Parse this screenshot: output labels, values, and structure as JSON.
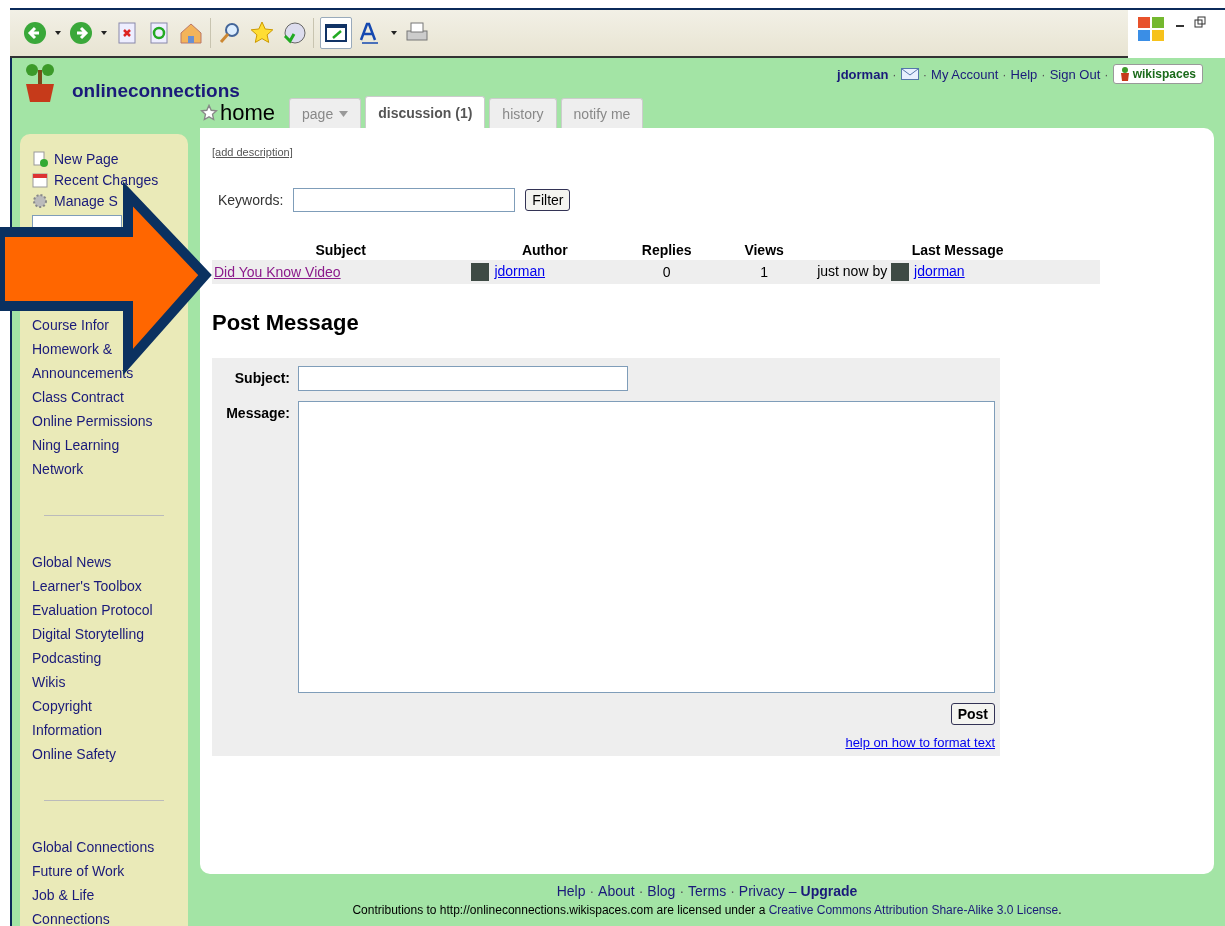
{
  "site": {
    "name": "onlineconnections",
    "page_title": "home"
  },
  "account": {
    "separator": "·",
    "user": "jdorman",
    "links": [
      "My Account",
      "Help",
      "Sign Out"
    ],
    "brand": "wikispaces"
  },
  "tabs": [
    {
      "label": "page",
      "selected": false,
      "kind": "dropdown"
    },
    {
      "label": "discussion (1)",
      "selected": true,
      "kind": "plain"
    },
    {
      "label": "history",
      "selected": false,
      "kind": "plain"
    },
    {
      "label": "notify me",
      "selected": false,
      "kind": "plain"
    }
  ],
  "sidebar": {
    "actions": [
      "New Page",
      "Recent Changes",
      "Manage S"
    ],
    "groups": [
      [
        "Course Infor",
        "Homework &",
        "Announcements",
        "Class Contract",
        "Online Permissions",
        "Ning Learning",
        "Network"
      ],
      [
        "Global News",
        "Learner's Toolbox",
        "Evaluation Protocol",
        "Digital Storytelling",
        "Podcasting",
        "Wikis",
        "Copyright",
        "Information",
        "Online Safety"
      ],
      [
        "Global Connections",
        "Future of Work",
        "Job & Life",
        "Connections"
      ]
    ]
  },
  "discussion": {
    "add_description": "[add description]",
    "keywords_label": "Keywords:",
    "filter_button": "Filter",
    "columns": [
      "Subject",
      "Author",
      "Replies",
      "Views",
      "Last Message"
    ],
    "rows": [
      {
        "subject": "Did You Know Video",
        "author": "jdorman",
        "replies": "0",
        "views": "1",
        "last_prefix": "just now by",
        "last_author": "jdorman"
      }
    ]
  },
  "post": {
    "heading": "Post Message",
    "subject_label": "Subject:",
    "message_label": "Message:",
    "button": "Post",
    "help_link": "help on how to format text"
  },
  "footer": {
    "separator": "·",
    "dash": "–",
    "links": [
      "Help",
      "About",
      "Blog",
      "Terms",
      "Privacy"
    ],
    "upgrade": "Upgrade",
    "license_prefix": "Contributions to http://onlineconnections.wikispaces.com are licensed under a",
    "license_link": "Creative Commons Attribution Share-Alike 3.0 License",
    "license_suffix": "."
  }
}
